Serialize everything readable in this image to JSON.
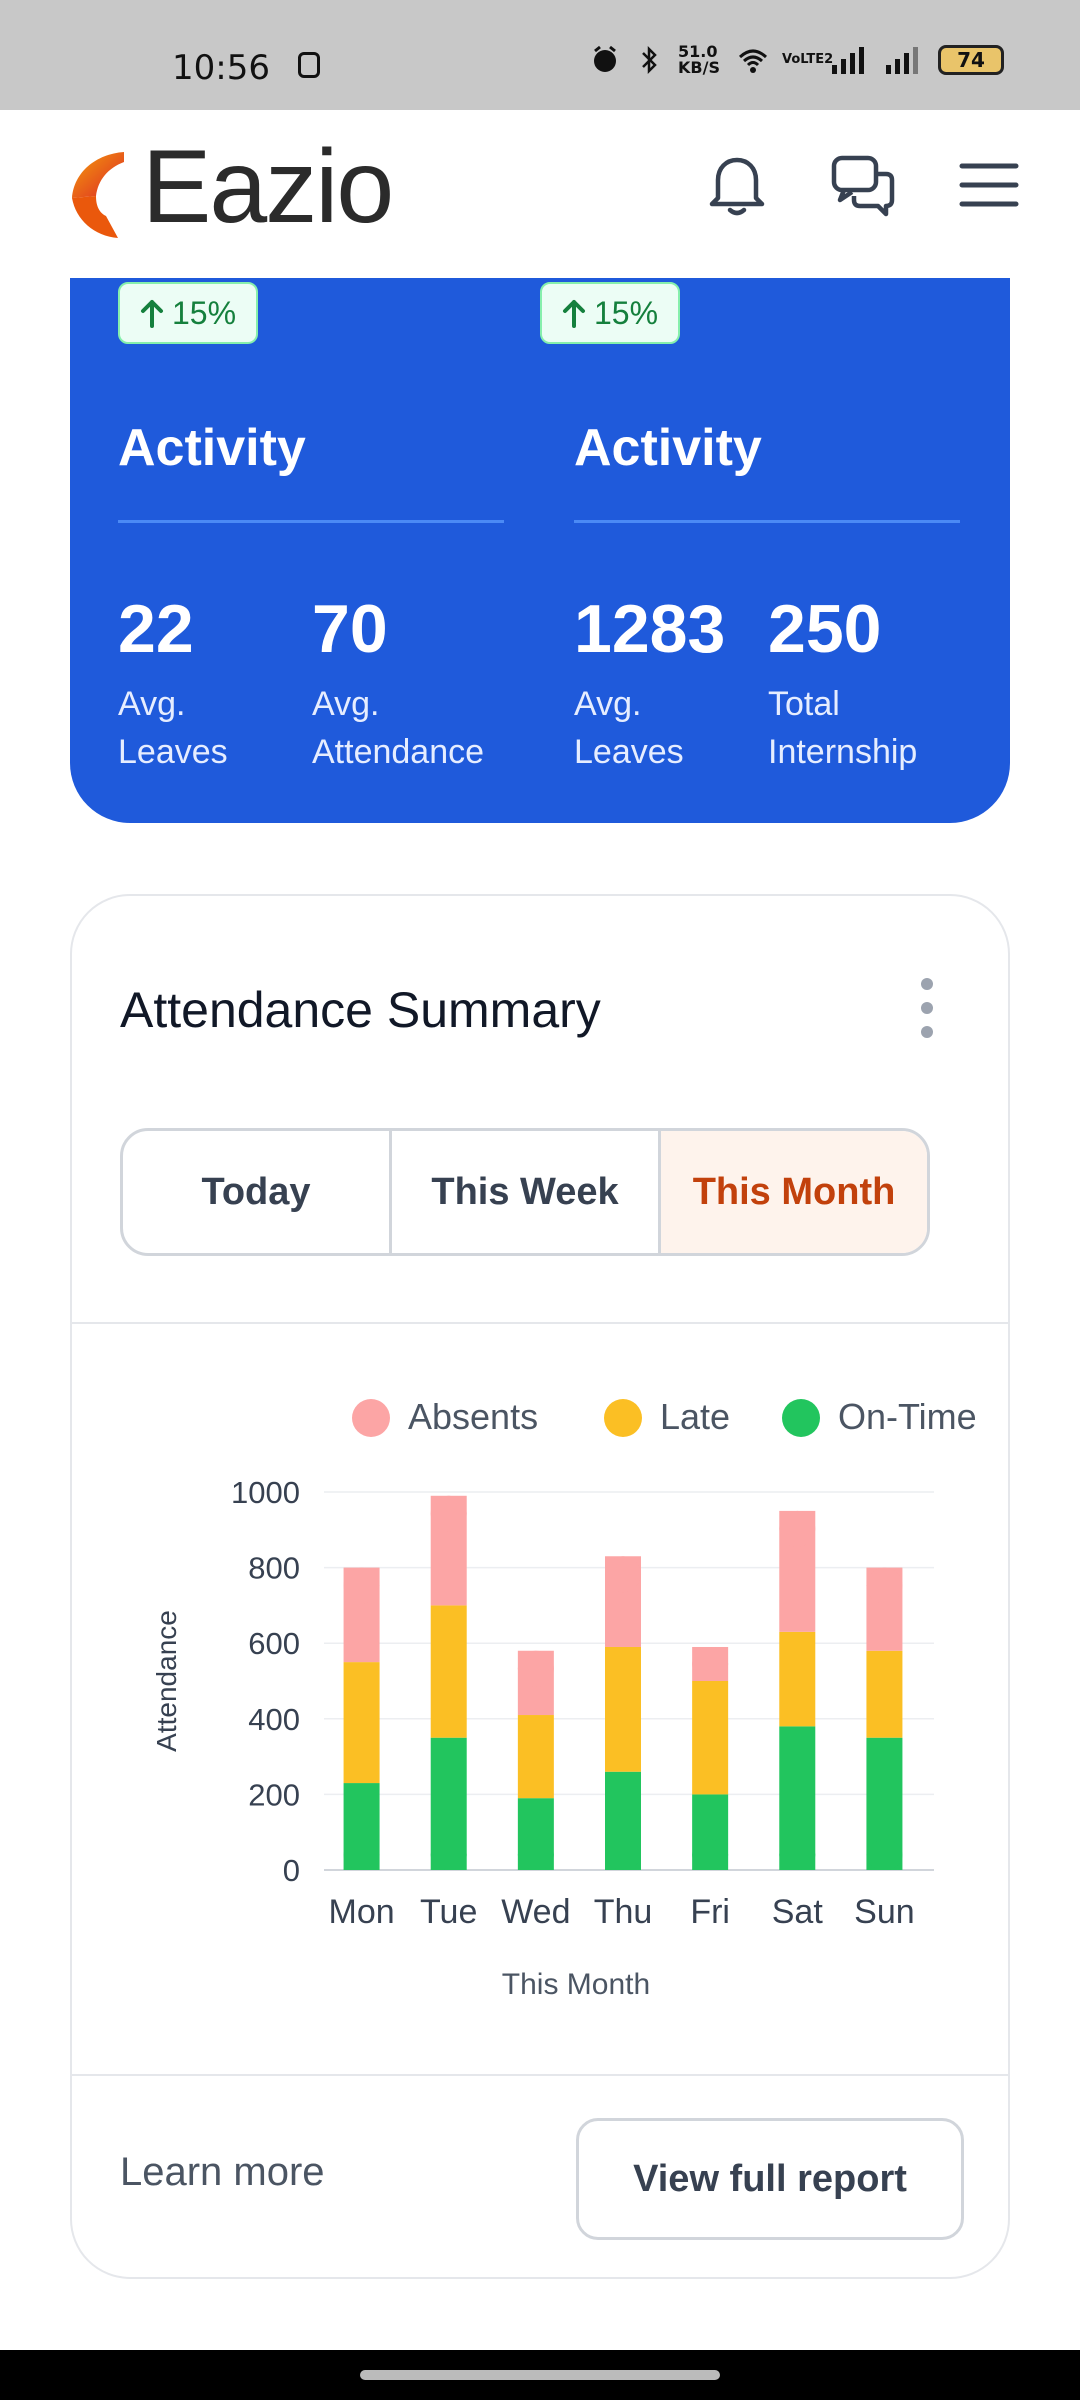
{
  "status_bar": {
    "time": "10:56",
    "net_speed": "51.0 KB/S",
    "network_label": "VoLTE2",
    "battery": "74"
  },
  "header": {
    "brand": "Eazio",
    "icons": [
      "bell-icon",
      "chat-icon",
      "menu-icon"
    ]
  },
  "activity_card": {
    "background": "#1f5adb",
    "columns": [
      {
        "badge": "15%",
        "title": "Activity",
        "stats": [
          {
            "value": "22",
            "label_line1": "Avg.",
            "label_line2": "Leaves"
          },
          {
            "value": "70",
            "label_line1": "Avg.",
            "label_line2": "Attendance"
          }
        ]
      },
      {
        "badge": "15%",
        "title": "Activity",
        "stats": [
          {
            "value": "1283",
            "label_line1": "Avg.",
            "label_line2": "Leaves"
          },
          {
            "value": "250",
            "label_line1": "Total",
            "label_line2": "Internship"
          }
        ]
      }
    ]
  },
  "summary": {
    "title": "Attendance Summary",
    "tabs": [
      "Today",
      "This Week",
      "This Month"
    ],
    "active_tab": "This Month",
    "learn_more": "Learn more",
    "report_button": "View full report"
  },
  "chart_data": {
    "type": "bar",
    "stacked": true,
    "categories": [
      "Mon",
      "Tue",
      "Wed",
      "Thu",
      "Fri",
      "Sat",
      "Sun"
    ],
    "series": [
      {
        "name": "On-Time",
        "color": "#22c55e",
        "values": [
          230,
          350,
          190,
          260,
          200,
          380,
          350
        ]
      },
      {
        "name": "Late",
        "color": "#fbbf24",
        "values": [
          320,
          350,
          220,
          330,
          300,
          250,
          230
        ]
      },
      {
        "name": "Absents",
        "color": "#fca5a5",
        "values": [
          250,
          290,
          170,
          240,
          90,
          320,
          220
        ]
      }
    ],
    "legend_order": [
      "Absents",
      "Late",
      "On-Time"
    ],
    "legend_position": "top",
    "xlabel": "This Month",
    "ylabel": "Attendance",
    "ylim": [
      0,
      1000
    ],
    "yticks": [
      0,
      200,
      400,
      600,
      800,
      1000
    ],
    "grid": true
  }
}
